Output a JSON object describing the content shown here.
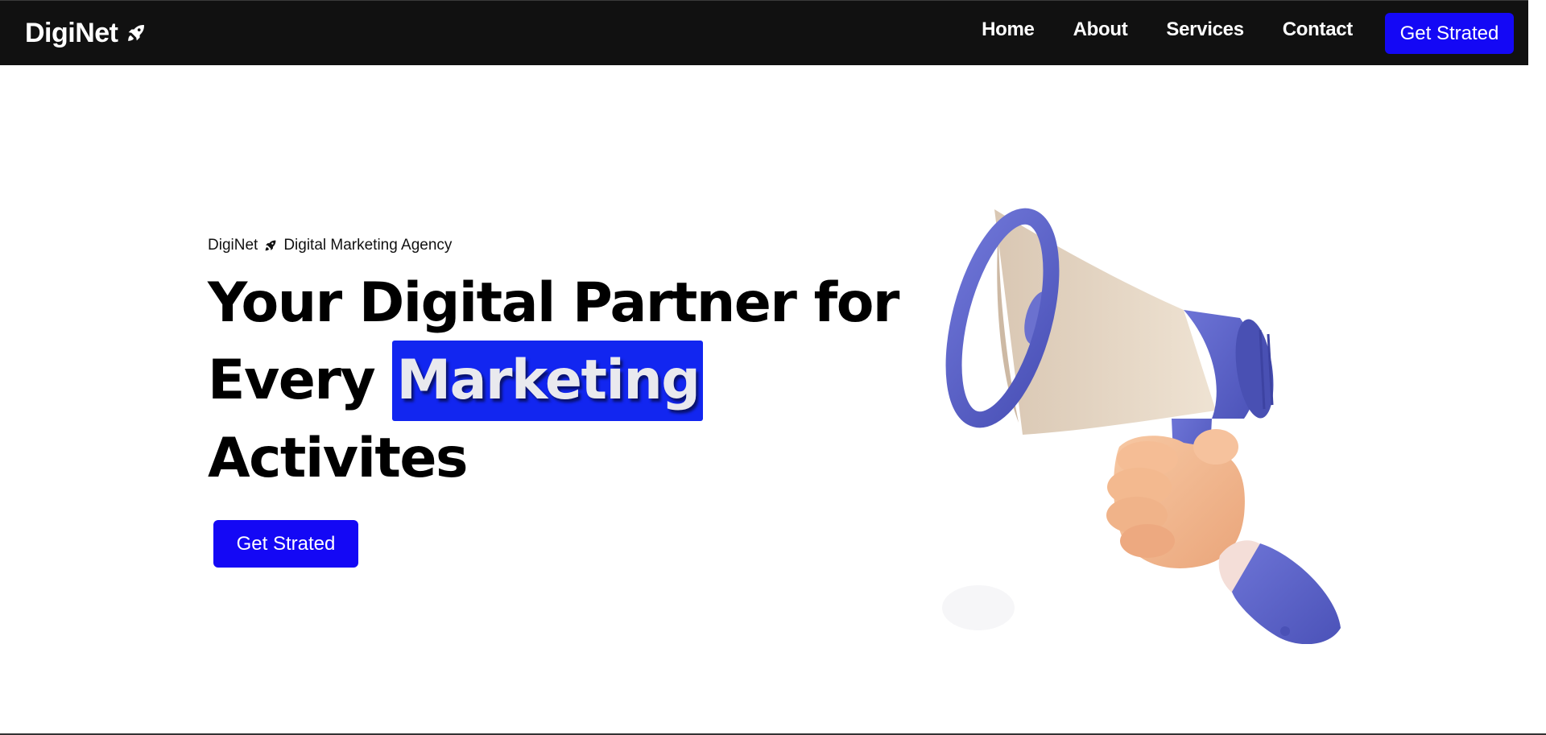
{
  "navbar": {
    "brand": "DigiNet",
    "brand_icon": "rocket-icon",
    "links": [
      {
        "label": "Home"
      },
      {
        "label": "About"
      },
      {
        "label": "Services"
      },
      {
        "label": "Contact"
      }
    ],
    "cta_label": "Get Strated"
  },
  "hero": {
    "eyebrow_brand": "DigiNet",
    "eyebrow_icon": "rocket-icon",
    "eyebrow_text": "Digital Marketing Agency",
    "headline_line1": "Your Digital Partner for",
    "headline_line2_prefix": "Every ",
    "headline_highlight": "Marketing",
    "headline_line3": "Activites",
    "cta_label": "Get Strated",
    "illustration": "megaphone-hand-illustration"
  },
  "colors": {
    "navbar_bg": "#111111",
    "accent": "#1408f5",
    "highlight_bg": "#1226f0",
    "megaphone_blue": "#5b63c9",
    "megaphone_cream": "#ead9c6",
    "skin": "#f3b98f"
  }
}
